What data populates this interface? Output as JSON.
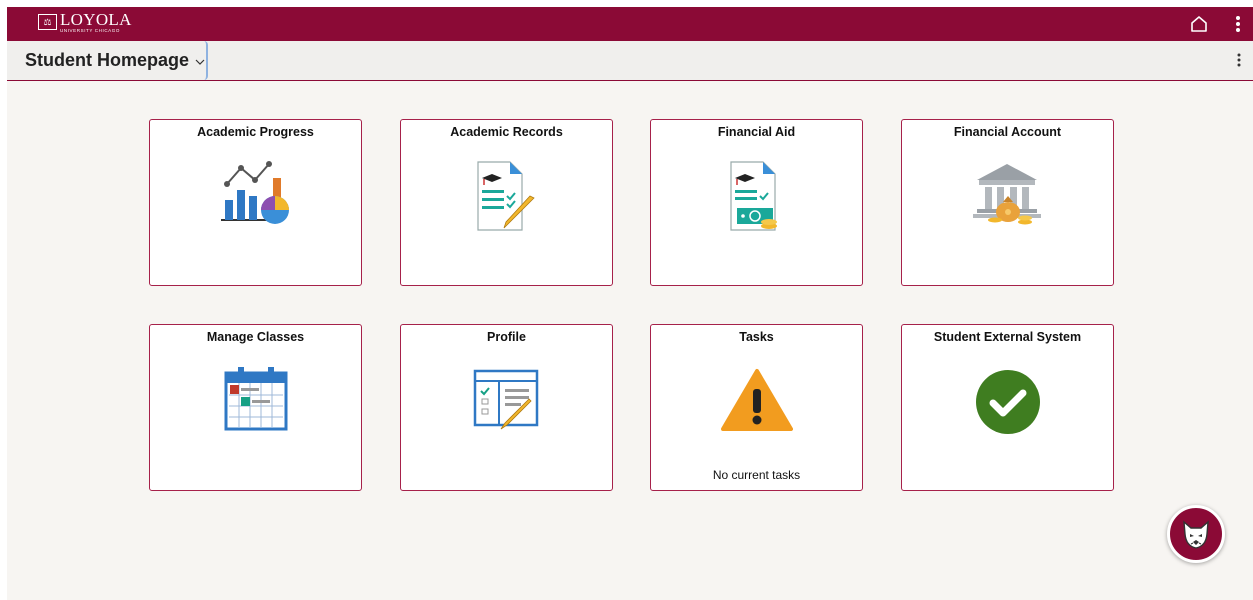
{
  "app": {
    "logo_name": "LOYOLA",
    "logo_subtitle": "UNIVERSITY CHICAGO"
  },
  "header": {
    "page_title": "Student Homepage"
  },
  "tiles": [
    {
      "title": "Academic Progress",
      "icon": "chart-icon"
    },
    {
      "title": "Academic Records",
      "icon": "records-icon"
    },
    {
      "title": "Financial Aid",
      "icon": "financial-aid-icon"
    },
    {
      "title": "Financial Account",
      "icon": "bank-icon"
    },
    {
      "title": "Manage Classes",
      "icon": "calendar-icon"
    },
    {
      "title": "Profile",
      "icon": "profile-icon"
    },
    {
      "title": "Tasks",
      "icon": "warning-icon",
      "note": "No current tasks"
    },
    {
      "title": "Student External System",
      "icon": "checkmark-icon"
    }
  ],
  "colors": {
    "brand": "#8b0a36",
    "tile_border": "#a6214a",
    "page_bg": "#f7f5f2"
  },
  "icons": {
    "home": "home-icon",
    "menu": "more-vertical-icon",
    "chat": "wolf-mascot-icon"
  }
}
